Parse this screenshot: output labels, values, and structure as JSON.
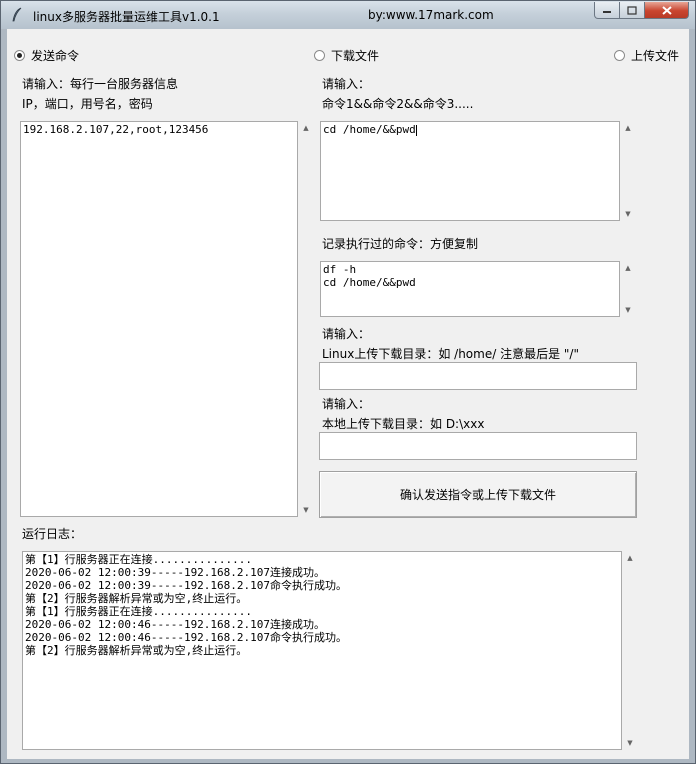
{
  "window": {
    "title": "linux多服务器批量运维工具v1.0.1",
    "by": "by:www.17mark.com",
    "min_icon": "minimize-icon",
    "max_icon": "maximize-icon",
    "close_icon": "close-icon"
  },
  "modes": {
    "send": "发送命令",
    "download": "下载文件",
    "upload": "上传文件",
    "selected": "send"
  },
  "servers": {
    "label1": "请输入：每行一台服务器信息",
    "label2": "IP，端口，用号名，密码",
    "value": "192.168.2.107,22,root,123456"
  },
  "command": {
    "label1": "请输入：",
    "label2": "命令1&&命令2&&命令3.....",
    "value": "cd /home/&&pwd"
  },
  "history": {
    "label": "记录执行过的命令：方便复制",
    "value": "df -h\ncd /home/&&pwd"
  },
  "remote_dir": {
    "label1": "请输入：",
    "label2": "Linux上传下载目录：如 /home/ 注意最后是 \"/\"",
    "value": ""
  },
  "local_dir": {
    "label1": "请输入：",
    "label2": "本地上传下载目录：如 D:\\xxx",
    "value": ""
  },
  "submit": {
    "label": "确认发送指令或上传下载文件"
  },
  "log": {
    "label": "运行日志：",
    "value": "第【1】行服务器正在连接...............\n2020-06-02 12:00:39-----192.168.2.107连接成功。\n2020-06-02 12:00:39-----192.168.2.107命令执行成功。\n第【2】行服务器解析异常或为空,终止运行。\n第【1】行服务器正在连接...............\n2020-06-02 12:00:46-----192.168.2.107连接成功。\n2020-06-02 12:00:46-----192.168.2.107命令执行成功。\n第【2】行服务器解析异常或为空,终止运行。"
  }
}
